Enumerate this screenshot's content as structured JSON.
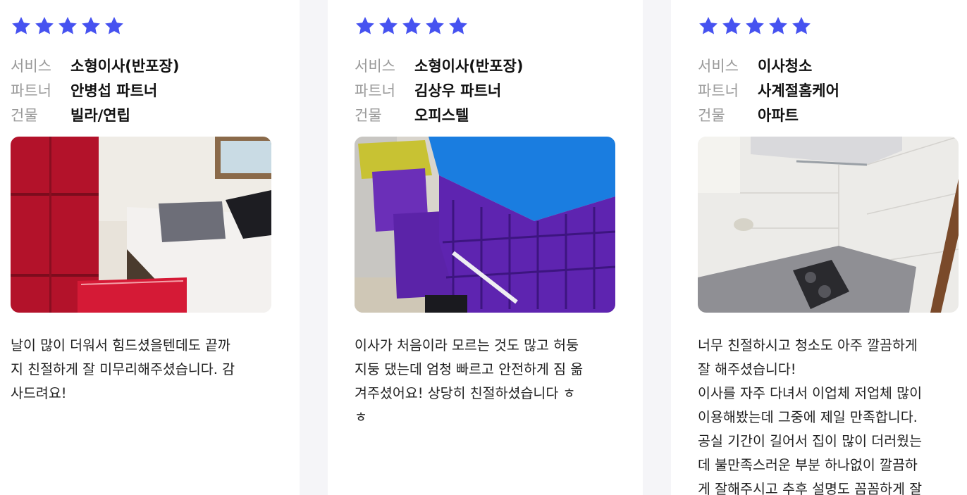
{
  "rating_color": "#4652f0",
  "meta_labels": {
    "service": "서비스",
    "partner": "파트너",
    "building": "건물"
  },
  "reviews": [
    {
      "rating": 5,
      "service": "소형이사(반포장)",
      "partner": "안병섭 파트너",
      "building": "빌라/연립",
      "photo": "room-with-red-boxes-and-bed",
      "text": "날이 많이 더워서 힘드셨을텐데도 끝까\n지 친절하게 잘 미무리해주셨습니다. 감\n사드려요!"
    },
    {
      "rating": 5,
      "service": "소형이사(반포장)",
      "partner": "김상우 파트너",
      "building": "오피스텔",
      "photo": "purple-moving-crates-with-blue-cover",
      "text": "이사가 처음이라 모르는 것도 많고 허둥\n지둥 댔는데 엄청 빠르고 안전하게 짐 옮\n겨주셨어요! 상당히 친절하셨습니다 ㅎ\nㅎ"
    },
    {
      "rating": 5,
      "service": "이사청소",
      "partner": "사계절홈케어",
      "building": "아파트",
      "photo": "clean-kitchen-with-gas-stove",
      "text": "너무 친절하시고 청소도 아주 깔끔하게\n잘 해주셨습니다!\n이사를 자주 다녀서 이업체 저업체 많이\n이용해봤는데 그중에 제일 만족합니다.\n공실 기간이 길어서 집이 많이 더러웠는\n데 불만족스러운 부분 하나없이 깔끔하\n게 잘해주시고 추후 설명도 꼼꼼하게 잘"
    }
  ]
}
